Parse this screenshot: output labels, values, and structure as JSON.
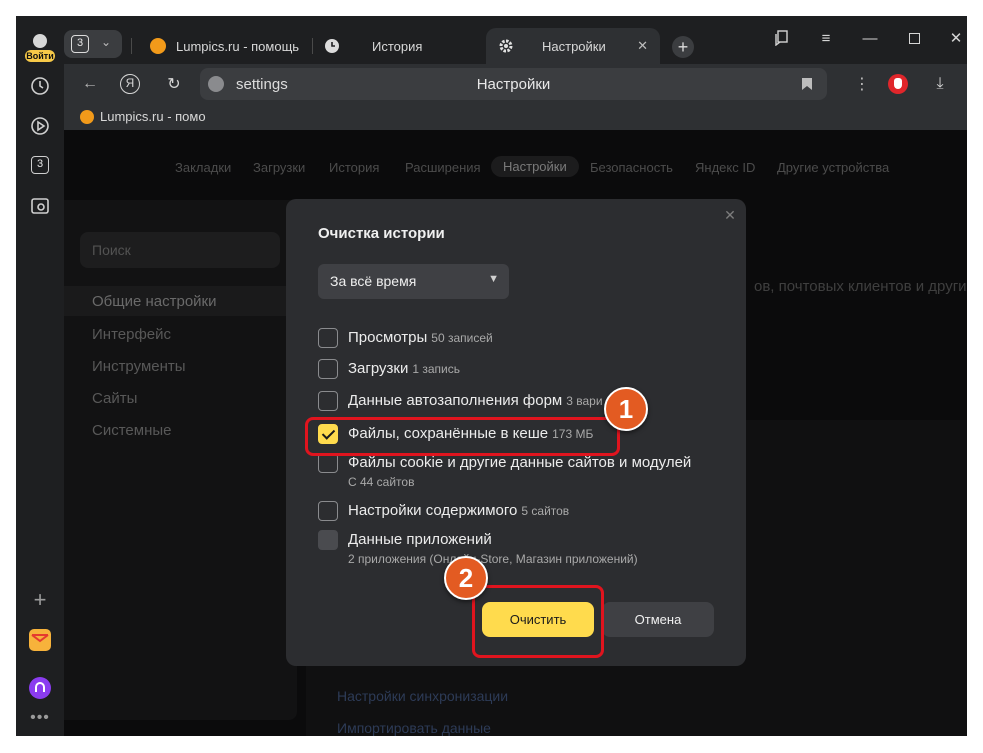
{
  "rail": {
    "login_label": "Войти",
    "tab_count": "3"
  },
  "tabs": [
    {
      "title": "Lumpics.ru - помощь",
      "icon": "lumpics-favicon",
      "color": "#f29a1a"
    },
    {
      "title": "История",
      "icon": "clock-icon"
    },
    {
      "title": "Настройки",
      "icon": "gear-icon"
    }
  ],
  "tab_counter": "3",
  "toolbar": {
    "url": "settings",
    "title": "Настройки",
    "yandex": "Я"
  },
  "bookmarks": [
    {
      "title": "Lumpics.ru - помо"
    }
  ],
  "settings_nav": [
    "Закладки",
    "Загрузки",
    "История",
    "Расширения",
    "Настройки",
    "Безопасность",
    "Яндекс ID",
    "Другие устройства"
  ],
  "sidebar": {
    "search_placeholder": "Поиск",
    "items": [
      "Общие настройки",
      "Интерфейс",
      "Инструменты",
      "Сайты",
      "Системные"
    ]
  },
  "background": {
    "text": "ов, почтовых клиентов и других",
    "link_sync": "Настройки синхронизации",
    "link_import": "Импортировать данные"
  },
  "dialog": {
    "title": "Очистка истории",
    "period": "За всё время",
    "options": [
      {
        "label": "Просмотры",
        "meta": "50 записей",
        "checked": false
      },
      {
        "label": "Загрузки",
        "meta": "1 запись",
        "checked": false
      },
      {
        "label": "Данные автозаполнения форм",
        "meta": "3 вари",
        "checked": false
      },
      {
        "label": "Файлы, сохранённые в кеше",
        "meta": "173 МБ",
        "checked": true
      },
      {
        "label": "Файлы cookie и другие данные сайтов и модулей",
        "sub": "С 44 сайтов",
        "checked": false
      },
      {
        "label": "Настройки содержимого",
        "meta": "5 сайтов",
        "checked": false
      },
      {
        "label": "Данные приложений",
        "sub": "2 приложения (Онлайн-Store, Магазин приложений)",
        "checked": false
      }
    ],
    "clear_label": "Очистить",
    "cancel_label": "Отмена"
  },
  "annotations": {
    "marker1": "1",
    "marker2": "2",
    "color": "#e0141e"
  },
  "colors": {
    "accent": "#ffdb4d",
    "dialog_bg": "#2c2d30",
    "page_bg": "#0b0b0c"
  }
}
